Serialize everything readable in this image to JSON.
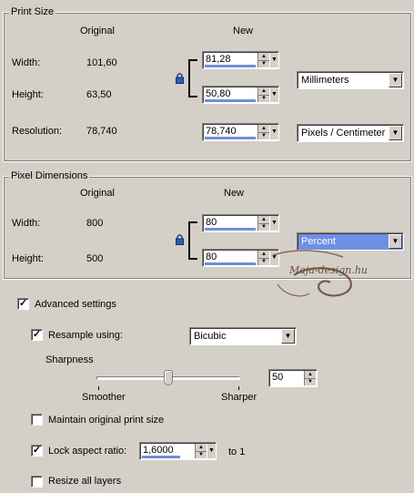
{
  "print_size": {
    "title": "Print Size",
    "col_original": "Original",
    "col_new": "New",
    "width_label": "Width:",
    "width_original": "101,60",
    "width_new": "81,28",
    "height_label": "Height:",
    "height_original": "63,50",
    "height_new": "50,80",
    "resolution_label": "Resolution:",
    "resolution_original": "78,740",
    "resolution_new": "78,740",
    "unit_select": "Millimeters",
    "res_unit_select": "Pixels / Centimeter"
  },
  "pixel_dimensions": {
    "title": "Pixel Dimensions",
    "col_original": "Original",
    "col_new": "New",
    "width_label": "Width:",
    "width_original": "800",
    "width_new": "80",
    "height_label": "Height:",
    "height_original": "500",
    "height_new": "80",
    "unit_select": "Percent"
  },
  "advanced": {
    "advanced_label": "Advanced settings",
    "advanced_checked": true,
    "resample_label": "Resample using:",
    "resample_checked": true,
    "resample_method": "Bicubic",
    "sharpness_label": "Sharpness",
    "smoother_label": "Smoother",
    "sharper_label": "Sharper",
    "sharpness_value": "50",
    "sharpness_level": 0.5,
    "maintain_label": "Maintain original print size",
    "maintain_checked": false,
    "lock_aspect_label": "Lock aspect ratio:",
    "lock_aspect_checked": true,
    "aspect_value": "1,6000",
    "aspect_suffix": "to 1",
    "resize_all_label": "Resize all layers",
    "resize_all_checked": false
  },
  "watermark": {
    "text": "Maja-design.hu"
  },
  "colors": {
    "face": "#d4d0c8",
    "highlight": "#6e8fe3",
    "watermark": "#6b5040"
  }
}
